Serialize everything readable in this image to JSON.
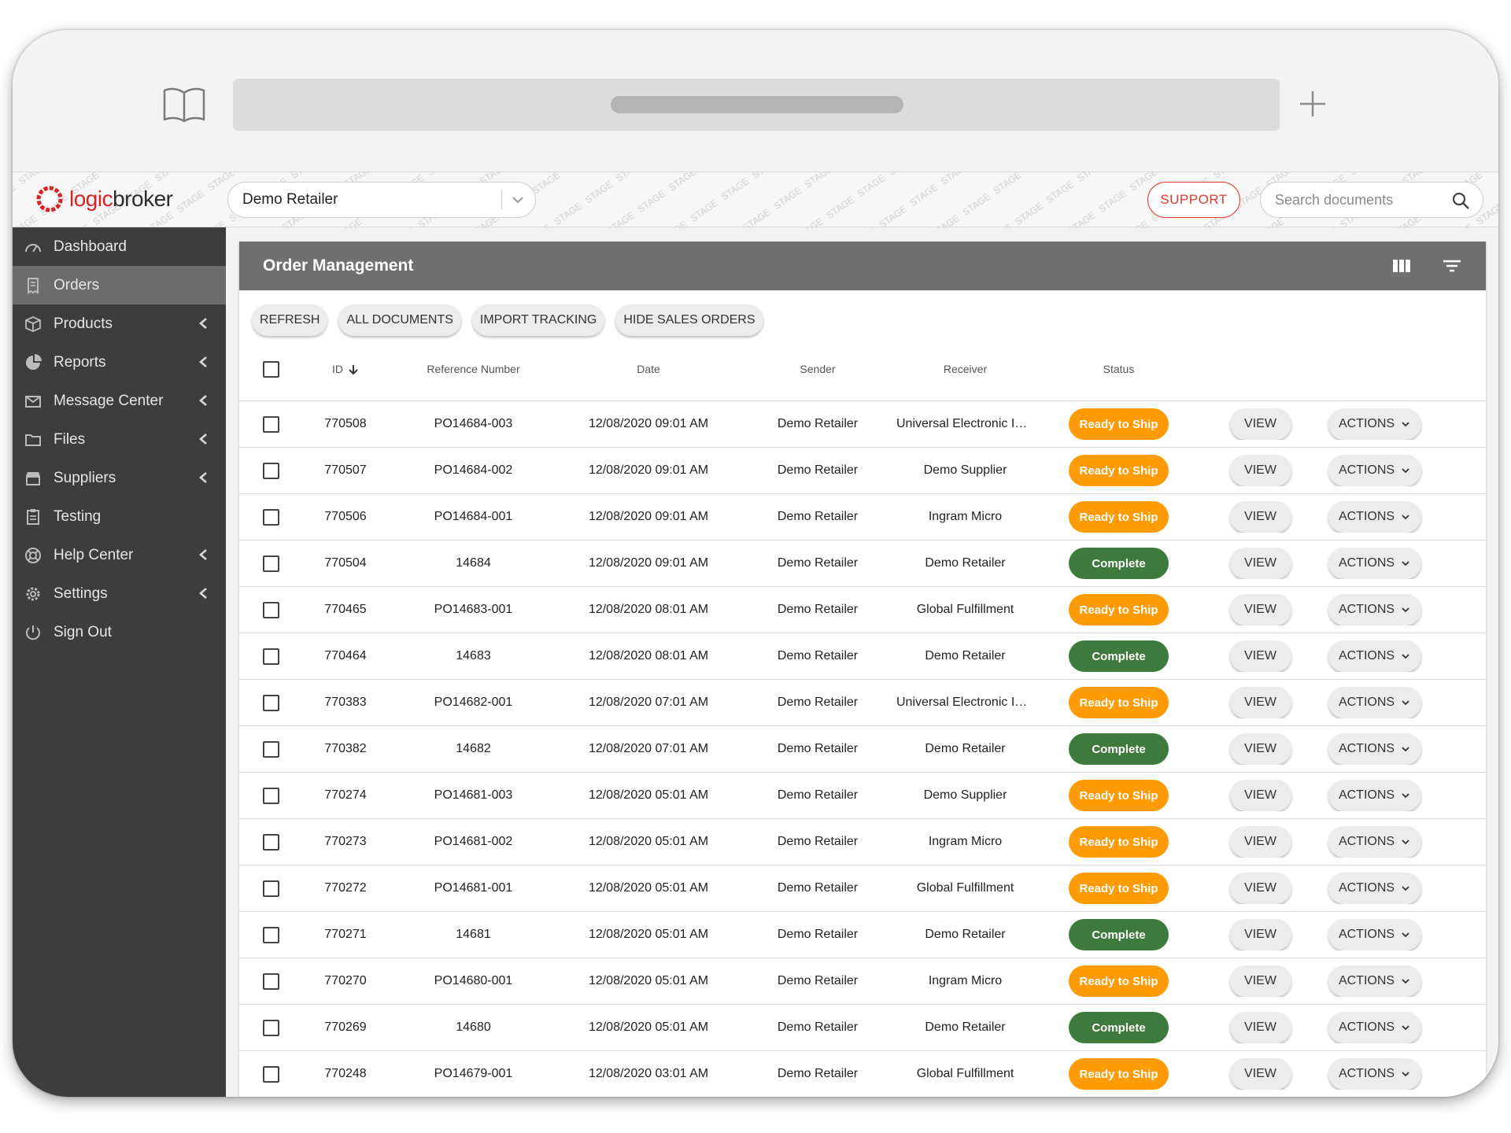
{
  "app": {
    "logo_part1": "logic",
    "logo_part2": "broker",
    "watermark": "STAGE",
    "brand_color": "#d92222"
  },
  "header": {
    "retailer": "Demo Retailer",
    "support_label": "SUPPORT",
    "search_placeholder": "Search documents"
  },
  "sidebar": {
    "items": [
      {
        "label": "Dashboard",
        "icon": "dashboard-gauge-icon",
        "caret": false,
        "active": false
      },
      {
        "label": "Orders",
        "icon": "orders-receipt-icon",
        "caret": false,
        "active": true
      },
      {
        "label": "Products",
        "icon": "products-box-icon",
        "caret": true,
        "active": false
      },
      {
        "label": "Reports",
        "icon": "reports-pie-icon",
        "caret": true,
        "active": false
      },
      {
        "label": "Message Center",
        "icon": "envelope-icon",
        "caret": true,
        "active": false
      },
      {
        "label": "Files",
        "icon": "folder-icon",
        "caret": true,
        "active": false
      },
      {
        "label": "Suppliers",
        "icon": "suppliers-store-icon",
        "caret": true,
        "active": false
      },
      {
        "label": "Testing",
        "icon": "clipboard-icon",
        "caret": false,
        "active": false
      },
      {
        "label": "Help Center",
        "icon": "lifebuoy-icon",
        "caret": true,
        "active": false
      },
      {
        "label": "Settings",
        "icon": "gear-icon",
        "caret": true,
        "active": false
      },
      {
        "label": "Sign Out",
        "icon": "power-icon",
        "caret": false,
        "active": false
      }
    ]
  },
  "panel": {
    "title": "Order Management",
    "toolbar": [
      "REFRESH",
      "ALL DOCUMENTS",
      "IMPORT TRACKING",
      "HIDE SALES ORDERS"
    ]
  },
  "table": {
    "headers": {
      "id": "ID",
      "ref": "Reference Number",
      "date": "Date",
      "sender": "Sender",
      "receiver": "Receiver",
      "status": "Status"
    },
    "view_label": "VIEW",
    "actions_label": "ACTIONS",
    "rows": [
      {
        "id": "770508",
        "ref": "PO14684-003",
        "date": "12/08/2020 09:01 AM",
        "sender": "Demo Retailer",
        "receiver": "Universal Electronic Integr...",
        "status": "Ready to Ship"
      },
      {
        "id": "770507",
        "ref": "PO14684-002",
        "date": "12/08/2020 09:01 AM",
        "sender": "Demo Retailer",
        "receiver": "Demo Supplier",
        "status": "Ready to Ship"
      },
      {
        "id": "770506",
        "ref": "PO14684-001",
        "date": "12/08/2020 09:01 AM",
        "sender": "Demo Retailer",
        "receiver": "Ingram Micro",
        "status": "Ready to Ship"
      },
      {
        "id": "770504",
        "ref": "14684",
        "date": "12/08/2020 09:01 AM",
        "sender": "Demo Retailer",
        "receiver": "Demo Retailer",
        "status": "Complete"
      },
      {
        "id": "770465",
        "ref": "PO14683-001",
        "date": "12/08/2020 08:01 AM",
        "sender": "Demo Retailer",
        "receiver": "Global Fulfillment",
        "status": "Ready to Ship"
      },
      {
        "id": "770464",
        "ref": "14683",
        "date": "12/08/2020 08:01 AM",
        "sender": "Demo Retailer",
        "receiver": "Demo Retailer",
        "status": "Complete"
      },
      {
        "id": "770383",
        "ref": "PO14682-001",
        "date": "12/08/2020 07:01 AM",
        "sender": "Demo Retailer",
        "receiver": "Universal Electronic Integr...",
        "status": "Ready to Ship"
      },
      {
        "id": "770382",
        "ref": "14682",
        "date": "12/08/2020 07:01 AM",
        "sender": "Demo Retailer",
        "receiver": "Demo Retailer",
        "status": "Complete"
      },
      {
        "id": "770274",
        "ref": "PO14681-003",
        "date": "12/08/2020 05:01 AM",
        "sender": "Demo Retailer",
        "receiver": "Demo Supplier",
        "status": "Ready to Ship"
      },
      {
        "id": "770273",
        "ref": "PO14681-002",
        "date": "12/08/2020 05:01 AM",
        "sender": "Demo Retailer",
        "receiver": "Ingram Micro",
        "status": "Ready to Ship"
      },
      {
        "id": "770272",
        "ref": "PO14681-001",
        "date": "12/08/2020 05:01 AM",
        "sender": "Demo Retailer",
        "receiver": "Global Fulfillment",
        "status": "Ready to Ship"
      },
      {
        "id": "770271",
        "ref": "14681",
        "date": "12/08/2020 05:01 AM",
        "sender": "Demo Retailer",
        "receiver": "Demo Retailer",
        "status": "Complete"
      },
      {
        "id": "770270",
        "ref": "PO14680-001",
        "date": "12/08/2020 05:01 AM",
        "sender": "Demo Retailer",
        "receiver": "Ingram Micro",
        "status": "Ready to Ship"
      },
      {
        "id": "770269",
        "ref": "14680",
        "date": "12/08/2020 05:01 AM",
        "sender": "Demo Retailer",
        "receiver": "Demo Retailer",
        "status": "Complete"
      },
      {
        "id": "770248",
        "ref": "PO14679-001",
        "date": "12/08/2020 03:01 AM",
        "sender": "Demo Retailer",
        "receiver": "Global Fulfillment",
        "status": "Ready to Ship"
      }
    ]
  },
  "colors": {
    "ready": "#ff9b06",
    "complete": "#3e7a3d",
    "sidebar": "#3d3d3d",
    "panel_header": "#707070"
  }
}
